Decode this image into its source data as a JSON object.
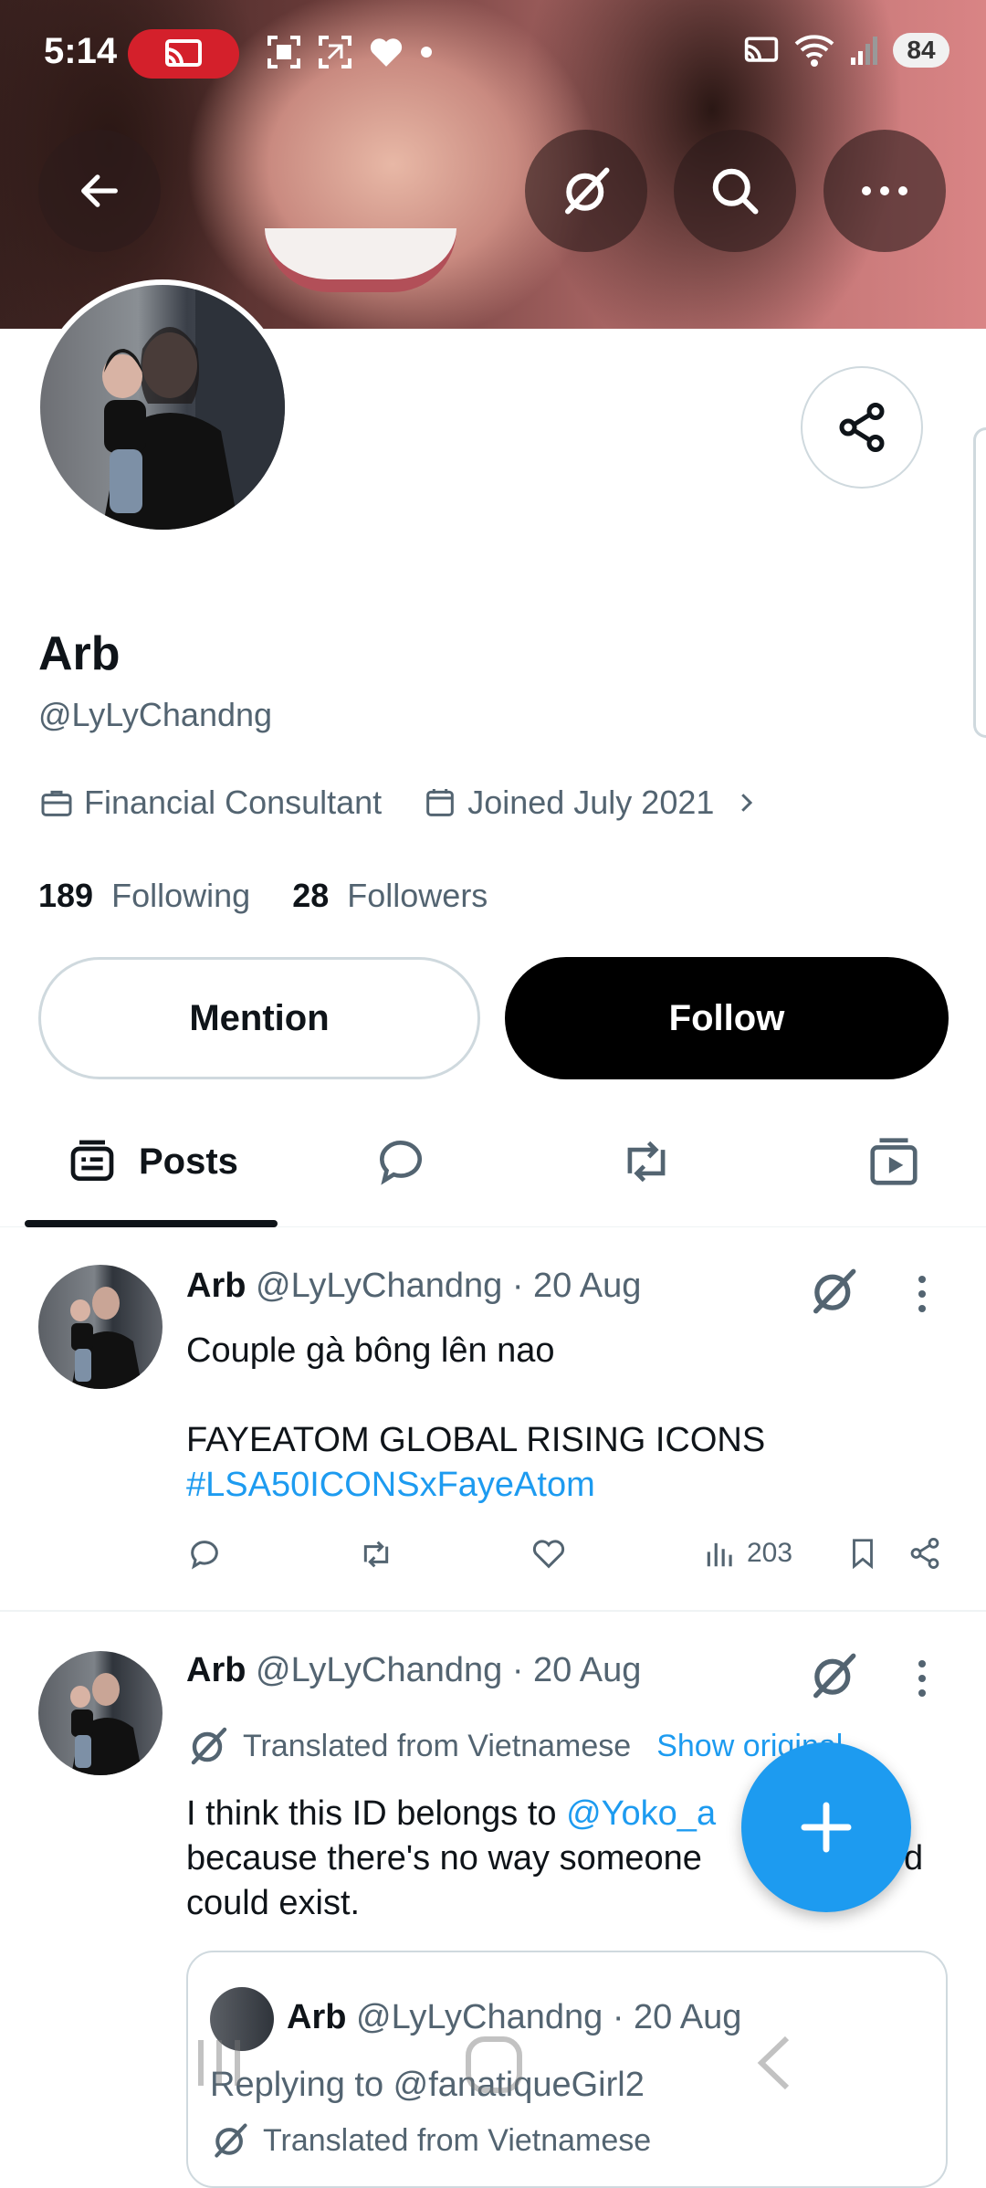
{
  "status_bar": {
    "time": "5:14",
    "battery": "84"
  },
  "header": {
    "back_icon": "arrow-left-icon",
    "grok_icon": "grok-icon",
    "search_icon": "search-icon",
    "more_icon": "more-horizontal-icon"
  },
  "profile": {
    "name": "Arb",
    "handle": "@LyLyChandng",
    "profession": "Financial Consultant",
    "joined": "Joined July 2021",
    "following_count": "189",
    "following_label": "Following",
    "followers_count": "28",
    "followers_label": "Followers",
    "mention_label": "Mention",
    "follow_label": "Follow"
  },
  "tabs": {
    "posts_label": "Posts"
  },
  "posts": [
    {
      "name": "Arb",
      "handle_date": "@LyLyChandng · 20 Aug",
      "text": "Couple gà bông lên nao\n\nFAYEATOM GLOBAL RISING ICONS",
      "hashtag": "#LSA50ICONSxFayeAtom",
      "views": "203"
    },
    {
      "name": "Arb",
      "handle_date": "@LyLyChandng · 20 Aug",
      "translated_label": "Translated from Vietnamese",
      "show_original": "Show original",
      "text_a": "I think this ID belongs to ",
      "mention": "@Yoko_a",
      "text_b": "because there's no way someone",
      "text_b_tail": "d",
      "text_c": "could exist."
    }
  ],
  "quoted": {
    "name": "Arb",
    "handle_date": "@LyLyChandng · 20 Aug",
    "replying": "Replying to @fanatiqueGirl2",
    "translated": "Translated from Vietnamese"
  },
  "colors": {
    "accent": "#1d9bf0",
    "text": "#0f1419",
    "secondary": "#536471",
    "cast_pill": "#d4202b"
  }
}
